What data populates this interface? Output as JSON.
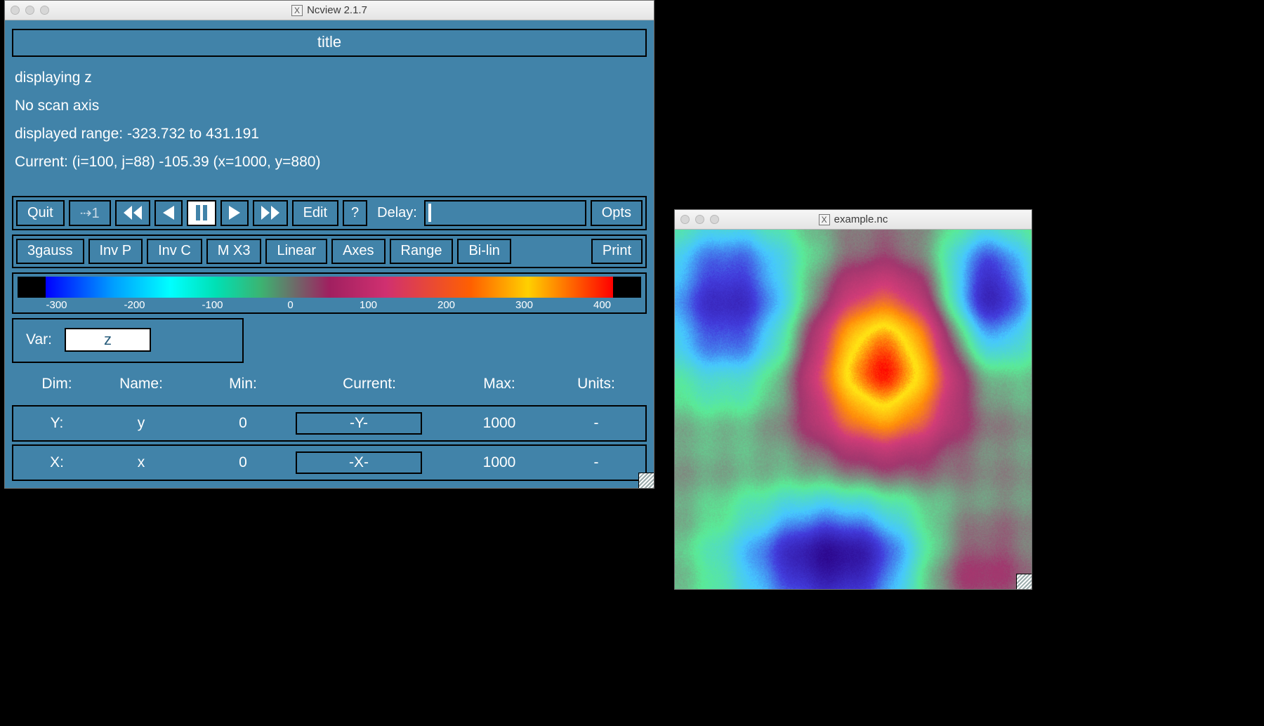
{
  "main_window": {
    "title": "Ncview 2.1.7",
    "header_title": "title",
    "info": {
      "displaying": "displaying z",
      "scan_axis": "No scan axis",
      "range": "displayed range: -323.732 to 431.191",
      "current": "Current: (i=100, j=88) -105.39 (x=1000, y=880)"
    },
    "toolbar1": {
      "quit": "Quit",
      "step_value": "⇢1",
      "edit": "Edit",
      "help": "?",
      "delay_label": "Delay:",
      "opts": "Opts"
    },
    "toolbar2": {
      "b1": "3gauss",
      "b2": "Inv P",
      "b3": "Inv C",
      "b4": "M X3",
      "b5": "Linear",
      "b6": "Axes",
      "b7": "Range",
      "b8": "Bi-lin",
      "b9": "Print"
    },
    "colorbar_ticks": [
      "-300",
      "-200",
      "-100",
      "0",
      "100",
      "200",
      "300",
      "400"
    ],
    "var": {
      "label": "Var:",
      "value": "z"
    },
    "dim_headers": {
      "dim": "Dim:",
      "name": "Name:",
      "min": "Min:",
      "current": "Current:",
      "max": "Max:",
      "units": "Units:"
    },
    "dims": [
      {
        "dim": "Y:",
        "name": "y",
        "min": "0",
        "current": "-Y-",
        "max": "1000",
        "units": "-"
      },
      {
        "dim": "X:",
        "name": "x",
        "min": "0",
        "current": "-X-",
        "max": "1000",
        "units": "-"
      }
    ]
  },
  "example_window": {
    "title": "example.nc"
  }
}
